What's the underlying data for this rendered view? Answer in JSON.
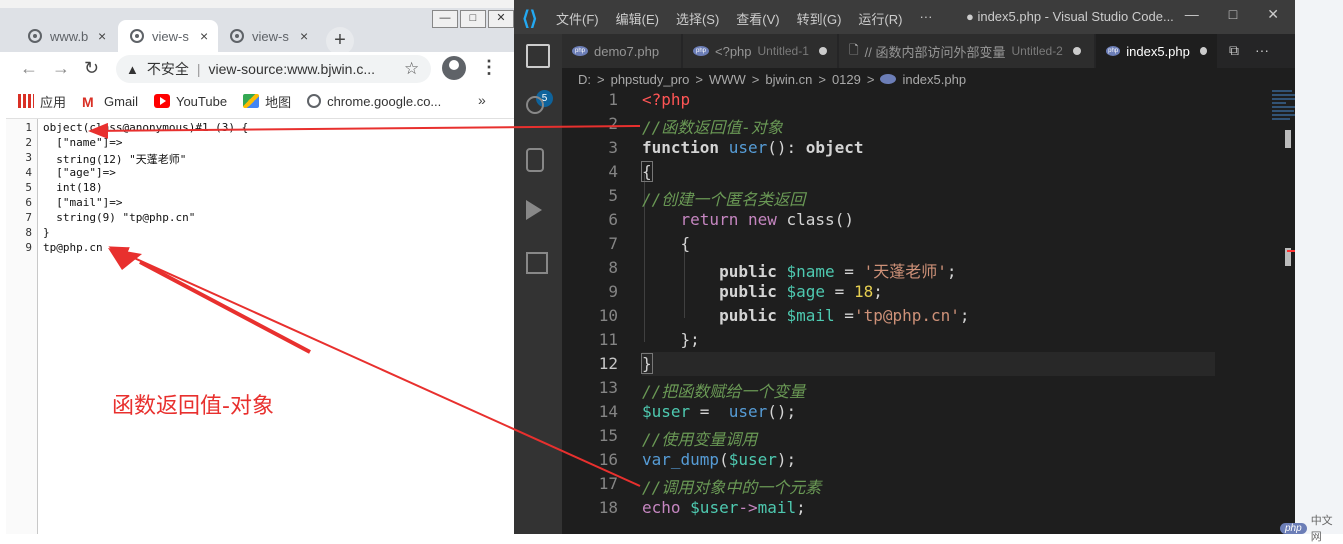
{
  "browser": {
    "tabs": [
      {
        "label": "www.b",
        "close": "×"
      },
      {
        "label": "view-s",
        "close": "×"
      },
      {
        "label": "view-s",
        "close": "×"
      }
    ],
    "new_tab": "+",
    "window_controls": [
      "—",
      "□",
      "✕"
    ],
    "nav": {
      "back": "←",
      "forward": "→",
      "reload": "↻"
    },
    "address": {
      "warning": "▲",
      "insecure_label": "不安全",
      "separator": "|",
      "url": "view-source:www.bjwin.c..."
    },
    "star": "☆",
    "menu": "⋮",
    "bookmarks": [
      {
        "label": "应用",
        "icon": "apps-icon"
      },
      {
        "label": "Gmail",
        "icon": "gmail-icon"
      },
      {
        "label": "YouTube",
        "icon": "youtube-icon"
      },
      {
        "label": "地图",
        "icon": "maps-icon"
      },
      {
        "label": "chrome.google.co...",
        "icon": "globe-icon"
      }
    ],
    "bookmarks_more": "»",
    "source": {
      "line_numbers": [
        "1",
        "2",
        "3",
        "4",
        "5",
        "6",
        "7",
        "8",
        "9"
      ],
      "lines": [
        "object(class@anonymous)#1 (3) {",
        "  [\"name\"]=>",
        "  string(12) \"天蓬老师\"",
        "  [\"age\"]=>",
        "  int(18)",
        "  [\"mail\"]=>",
        "  string(9) \"tp@php.cn\"",
        "}",
        "tp@php.cn"
      ]
    }
  },
  "annotation": {
    "text": "函数返回值-对象",
    "color": "#e8302e"
  },
  "vscode": {
    "menu": [
      "文件(F)",
      "编辑(E)",
      "选择(S)",
      "查看(V)",
      "转到(G)",
      "运行(R)",
      "···"
    ],
    "title": "● index5.php - Visual Studio Code...",
    "window_controls": [
      "—",
      "□",
      "✕"
    ],
    "activity_badge": "5",
    "tabs": [
      {
        "label": "demo7.php",
        "sub": "",
        "modified": false
      },
      {
        "label": "<?php",
        "sub": "Untitled-1",
        "modified": true
      },
      {
        "label": "// 函数内部访问外部变量",
        "sub": "Untitled-2",
        "modified": true
      },
      {
        "label": "index5.php",
        "sub": "",
        "modified": true
      }
    ],
    "tab_actions": [
      "⧉",
      "···"
    ],
    "breadcrumb": [
      "D:",
      "phpstudy_pro",
      "WWW",
      "bjwin.cn",
      "0129",
      "index5.php"
    ],
    "breadcrumb_sep": ">",
    "line_numbers": [
      "1",
      "2",
      "3",
      "4",
      "5",
      "6",
      "7",
      "8",
      "9",
      "10",
      "11",
      "12",
      "13",
      "14",
      "15",
      "16",
      "17",
      "18"
    ],
    "code": {
      "l1": "<?php",
      "l2": "//函数返回值-对象",
      "l3_kw": "function",
      "l3_fn": "user",
      "l3_paren": "(): ",
      "l3_ty": "object",
      "l4": "{",
      "l5": "//创建一个匿名类返回",
      "l6_ret": "return",
      "l6_new": "new",
      "l6_cls": "class",
      "l6_paren": "()",
      "l7": "{",
      "l8_pub": "public",
      "l8_var": "$name",
      "l8_eq": " = ",
      "l8_str": "'天蓬老师'",
      "l8_end": ";",
      "l9_pub": "public",
      "l9_var": "$age",
      "l9_eq": " = ",
      "l9_num": "18",
      "l9_end": ";",
      "l10_pub": "public",
      "l10_var": "$mail",
      "l10_eq": " =",
      "l10_str": "'tp@php.cn'",
      "l10_end": ";",
      "l11": "};",
      "l12": "}",
      "l13": "//把函数赋给一个变量",
      "l14_var": "$user",
      "l14_eq": " =  ",
      "l14_fn": "user",
      "l14_end": "();",
      "l15": "//使用变量调用",
      "l16_fn": "var_dump",
      "l16_open": "(",
      "l16_var": "$user",
      "l16_close": ");",
      "l17": "//调用对象中的一个元素",
      "l18_echo": "echo",
      "l18_var": "$user",
      "l18_arrow": "->",
      "l18_prop": "mail",
      "l18_end": ";"
    }
  },
  "watermark": {
    "logo": "php",
    "text": "中文网"
  }
}
